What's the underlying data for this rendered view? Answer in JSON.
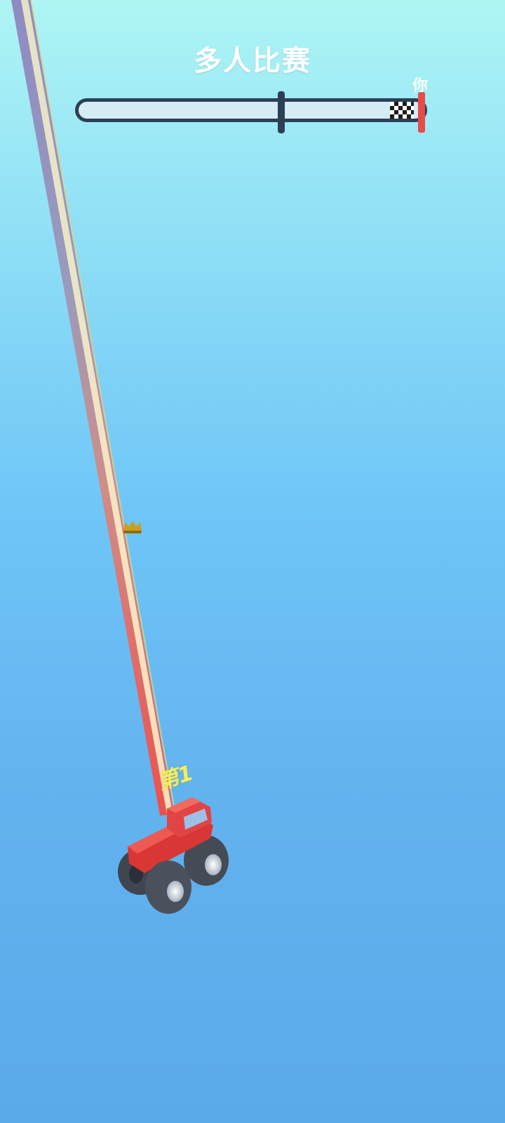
{
  "header": {
    "title": "多人比赛"
  },
  "race_progress": {
    "opponent_progress": 0.59,
    "player_progress": 1.0,
    "player_label": "你"
  },
  "player": {
    "rank_label": "第1",
    "vehicle": "monster-truck",
    "color": "#e84040"
  },
  "pickup": {
    "icon": "crown-icon",
    "color": "#c9a020"
  },
  "colors": {
    "track_border": "#2d3f55",
    "track_fill": "#d4ecf4",
    "player_marker": "#e84a4a",
    "rank_text": "#f2ee62"
  }
}
